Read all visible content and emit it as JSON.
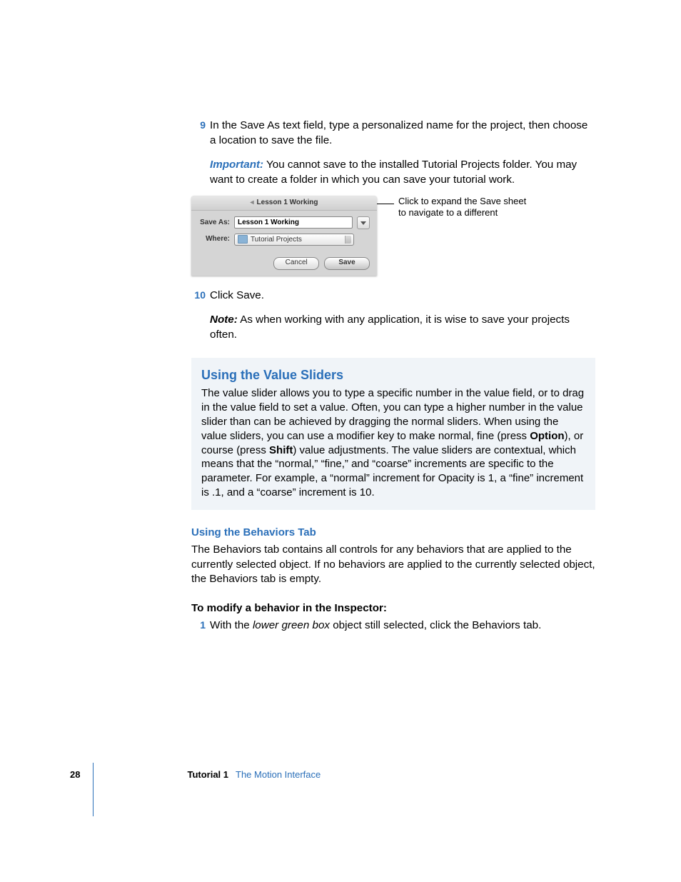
{
  "step9": {
    "num": "9",
    "text": "In the Save As text field, type a personalized name for the project, then choose a location to save the file."
  },
  "important": {
    "label": "Important:",
    "text": "You cannot save to the installed Tutorial Projects folder. You may want to create a folder in which you can save your tutorial work."
  },
  "sheet": {
    "title": "Lesson 1 Working",
    "saveAsLabel": "Save As:",
    "saveAsValue": "Lesson 1 Working",
    "whereLabel": "Where:",
    "whereValue": "Tutorial Projects",
    "cancel": "Cancel",
    "save": "Save"
  },
  "callout": {
    "line1": "Click to expand the Save sheet",
    "line2": "to navigate to a different"
  },
  "step10": {
    "num": "10",
    "text": "Click Save."
  },
  "note": {
    "label": "Note:",
    "text": "As when working with any application, it is wise to save your projects often."
  },
  "sidebar": {
    "heading": "Using the Value Sliders",
    "body_parts": [
      "The value slider allows you to type a specific number in the value field, or to drag in the value field to set a value. Often, you can type a higher number in the value slider than can be achieved by dragging the normal sliders. When using the value sliders, you can use a modifier key to make normal, fine (press ",
      "Option",
      "), or course (press ",
      "Shift",
      ") value adjustments. The value sliders are contextual, which means that the “normal,” “fine,” and “coarse” increments are specific to the parameter. For example, a “normal” increment for Opacity is 1, a “fine” increment is .1, and a “coarse” increment is 10."
    ]
  },
  "behaviors": {
    "heading": "Using the Behaviors Tab",
    "body": "The Behaviors tab contains all controls for any behaviors that are applied to the currently selected object. If no behaviors are applied to the currently selected object, the Behaviors tab is empty."
  },
  "modify": {
    "heading": "To modify a behavior in the Inspector:",
    "step1num": "1",
    "step1_pre": "With the ",
    "step1_italic": "lower green box",
    "step1_post": " object still selected, click the Behaviors tab."
  },
  "footer": {
    "page": "28",
    "tutorial": "Tutorial 1",
    "chapter": "The Motion Interface"
  }
}
